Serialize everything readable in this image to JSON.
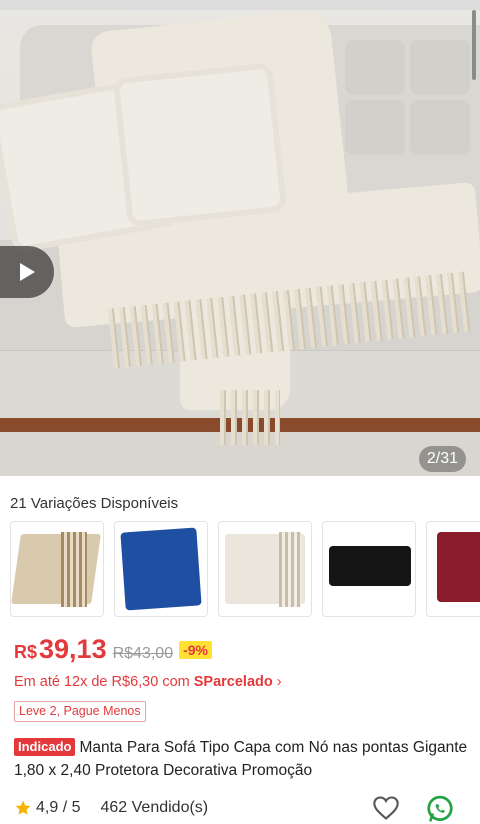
{
  "gallery": {
    "page_indicator": "2/31",
    "play_icon": "play-icon"
  },
  "variants": {
    "title": "21 Variações Disponíveis",
    "colors": [
      "#d9c9ad",
      "#1f4fa3",
      "#ebe6dc",
      "#151515",
      "#8a1c2c"
    ]
  },
  "price": {
    "currency": "R$",
    "current": "39,13",
    "original": "R$43,00",
    "discount": "-9%"
  },
  "installment": {
    "prefix": "Em até 12x de R$6,30 com",
    "provider": "SParcelado",
    "chevron": "›"
  },
  "promo_tag": "Leve 2, Pague Menos",
  "product": {
    "badge": "Indicado",
    "title": "Manta Para Sofá Tipo Capa com Nó nas pontas Gigante 1,80 x 2,40 Protetora Decorativa Promoção"
  },
  "stats": {
    "rating": "4,9 / 5",
    "sold": "462 Vendido(s)"
  },
  "icons": [
    "star-icon",
    "heart-icon",
    "whatsapp-icon"
  ]
}
